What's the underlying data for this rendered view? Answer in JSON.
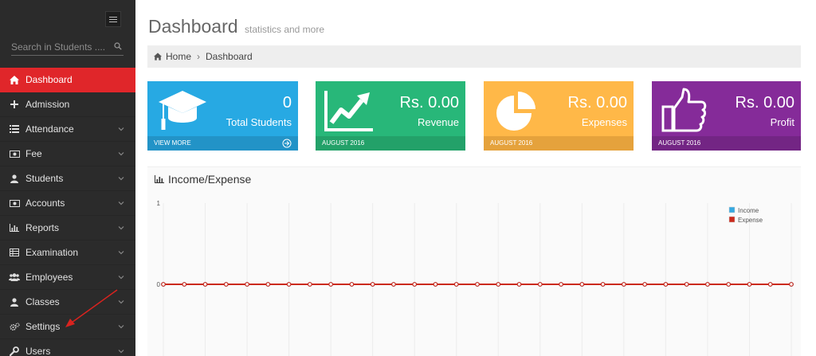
{
  "sidebar": {
    "search_placeholder": "Search in Students ....",
    "items": [
      {
        "label": "Dashboard",
        "icon": "home-icon",
        "active": true,
        "chevron": false
      },
      {
        "label": "Admission",
        "icon": "plus-icon",
        "active": false,
        "chevron": false
      },
      {
        "label": "Attendance",
        "icon": "list-icon",
        "active": false,
        "chevron": true
      },
      {
        "label": "Fee",
        "icon": "money-icon",
        "active": false,
        "chevron": true
      },
      {
        "label": "Students",
        "icon": "user-icon",
        "active": false,
        "chevron": true
      },
      {
        "label": "Accounts",
        "icon": "money-icon",
        "active": false,
        "chevron": true
      },
      {
        "label": "Reports",
        "icon": "bar-chart-icon",
        "active": false,
        "chevron": true
      },
      {
        "label": "Examination",
        "icon": "table-icon",
        "active": false,
        "chevron": true
      },
      {
        "label": "Employees",
        "icon": "users-icon",
        "active": false,
        "chevron": true
      },
      {
        "label": "Classes",
        "icon": "user-icon",
        "active": false,
        "chevron": true
      },
      {
        "label": "Settings",
        "icon": "cogs-icon",
        "active": false,
        "chevron": true
      },
      {
        "label": "Users",
        "icon": "wrench-icon",
        "active": false,
        "chevron": true
      }
    ]
  },
  "header": {
    "title": "Dashboard",
    "subtitle": "statistics and more"
  },
  "breadcrumb": {
    "home": "Home",
    "current": "Dashboard"
  },
  "tiles": [
    {
      "value": "0",
      "label": "Total Students",
      "footer": "VIEW MORE",
      "color": "#27a9e3",
      "icon": "graduation-cap-icon"
    },
    {
      "value": "Rs. 0.00",
      "label": "Revenue",
      "footer": "AUGUST 2016",
      "color": "#28b779",
      "icon": "line-chart-icon"
    },
    {
      "value": "Rs. 0.00",
      "label": "Expenses",
      "footer": "AUGUST 2016",
      "color": "#ffb848",
      "icon": "pie-chart-icon"
    },
    {
      "value": "Rs. 0.00",
      "label": "Profit",
      "footer": "AUGUST 2016",
      "color": "#852b99",
      "icon": "thumbs-up-icon"
    }
  ],
  "chart_panel": {
    "title": "Income/Expense"
  },
  "chart_data": {
    "type": "line",
    "title": "",
    "xlabel": "",
    "ylabel": "",
    "ylim": [
      0,
      1
    ],
    "y_ticks": [
      "0",
      "1"
    ],
    "grid": true,
    "legend_position": "top-right",
    "x_count": 31,
    "series": [
      {
        "name": "Income",
        "color": "#36a9e1",
        "values": [
          0,
          0,
          0,
          0,
          0,
          0,
          0,
          0,
          0,
          0,
          0,
          0,
          0,
          0,
          0,
          0,
          0,
          0,
          0,
          0,
          0,
          0,
          0,
          0,
          0,
          0,
          0,
          0,
          0,
          0,
          0
        ]
      },
      {
        "name": "Expense",
        "color": "#cb2a1c",
        "values": [
          0,
          0,
          0,
          0,
          0,
          0,
          0,
          0,
          0,
          0,
          0,
          0,
          0,
          0,
          0,
          0,
          0,
          0,
          0,
          0,
          0,
          0,
          0,
          0,
          0,
          0,
          0,
          0,
          0,
          0,
          0
        ]
      }
    ]
  }
}
